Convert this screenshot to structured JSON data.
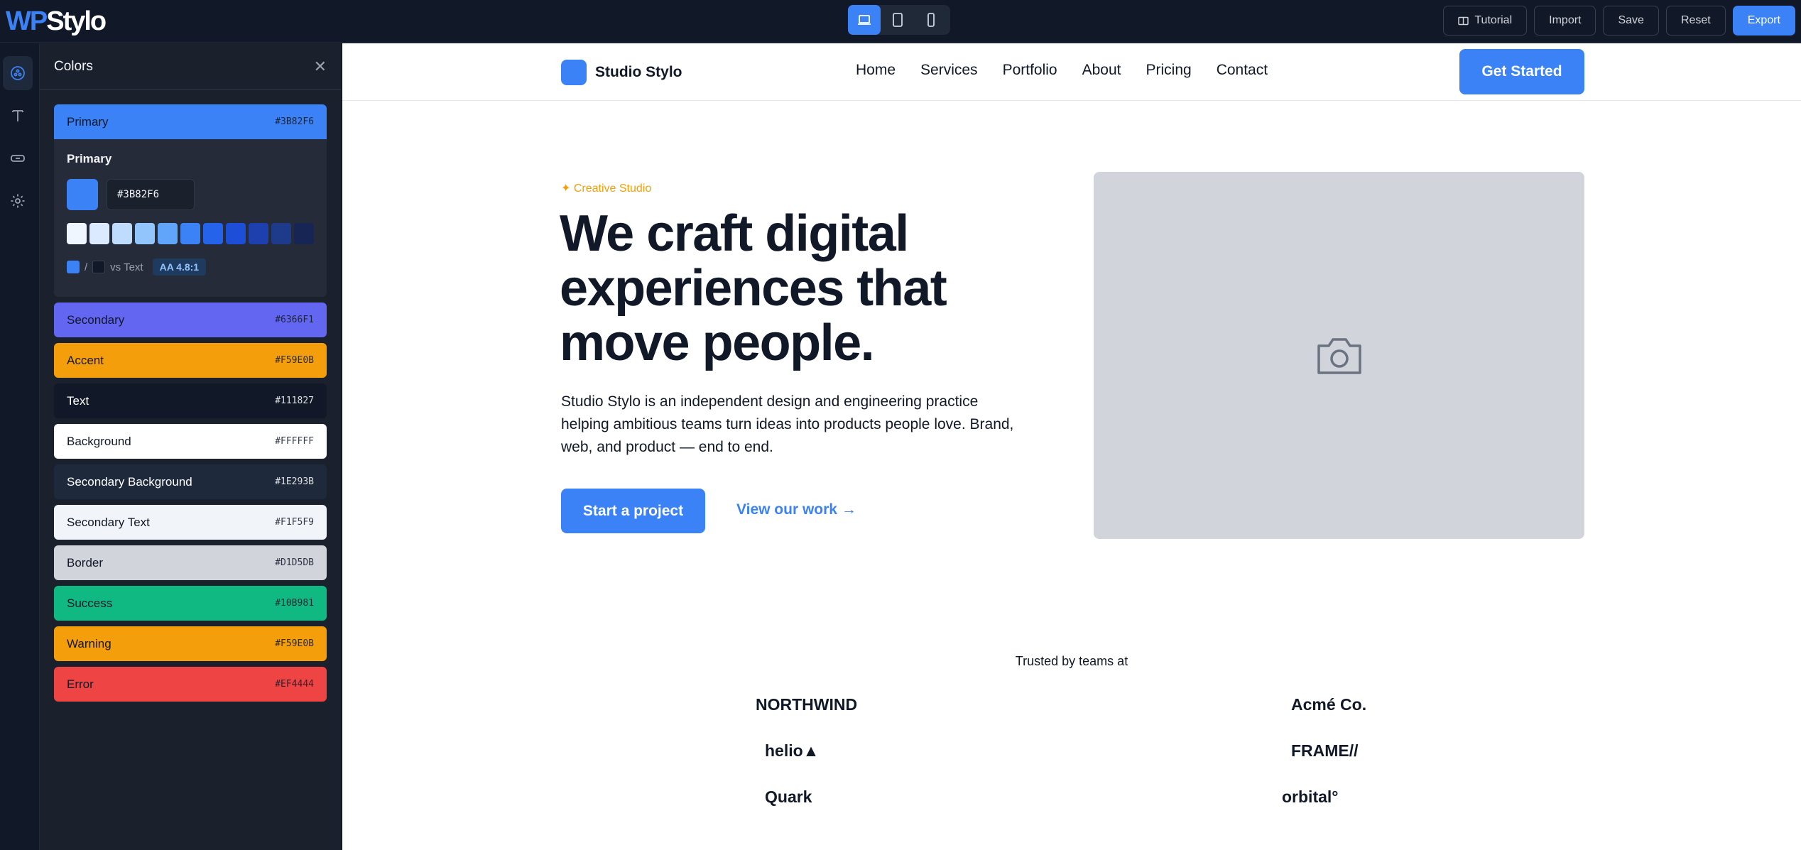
{
  "app": {
    "logo_wp": "WP",
    "logo_stylo": "Stylo"
  },
  "toolbar": {
    "devices": [
      {
        "name": "desktop-icon",
        "active": true
      },
      {
        "name": "tablet-icon",
        "active": false
      },
      {
        "name": "mobile-icon",
        "active": false
      }
    ],
    "tutorial_label": "Tutorial",
    "import_label": "Import",
    "save_label": "Save",
    "reset_label": "Reset",
    "export_label": "Export"
  },
  "rail": {
    "items": [
      {
        "icon": "palette-icon",
        "active": true
      },
      {
        "icon": "typography-icon",
        "active": false
      },
      {
        "icon": "button-icon",
        "active": false
      },
      {
        "icon": "gear-icon",
        "active": false
      }
    ]
  },
  "panel": {
    "title": "Colors",
    "close_icon": "close-icon",
    "colors": [
      {
        "label": "Primary",
        "hex": "#3B82F6",
        "bg": "#3B82F6",
        "fg": "#111827"
      },
      {
        "label": "Secondary",
        "hex": "#6366F1",
        "bg": "#6366F1",
        "fg": "#111827"
      },
      {
        "label": "Accent",
        "hex": "#F59E0B",
        "bg": "#F59E0B",
        "fg": "#111827"
      },
      {
        "label": "Text",
        "hex": "#111827",
        "bg": "#111827",
        "fg": "#FFFFFF"
      },
      {
        "label": "Background",
        "hex": "#FFFFFF",
        "bg": "#FFFFFF",
        "fg": "#111827"
      },
      {
        "label": "Secondary Background",
        "hex": "#1E293B",
        "bg": "#1E293B",
        "fg": "#FFFFFF"
      },
      {
        "label": "Secondary Text",
        "hex": "#F1F5F9",
        "bg": "#F1F5F9",
        "fg": "#111827"
      },
      {
        "label": "Border",
        "hex": "#D1D5DB",
        "bg": "#D1D5DB",
        "fg": "#111827"
      },
      {
        "label": "Success",
        "hex": "#10B981",
        "bg": "#10B981",
        "fg": "#111827"
      },
      {
        "label": "Warning",
        "hex": "#F59E0B",
        "bg": "#F59E0B",
        "fg": "#111827"
      },
      {
        "label": "Error",
        "hex": "#EF4444",
        "bg": "#EF4444",
        "fg": "#111827"
      }
    ],
    "editor": {
      "title": "Primary",
      "hex_value": "#3B82F6",
      "shades": [
        "#EFF6FF",
        "#DBEAFE",
        "#BFDBFE",
        "#93C5FD",
        "#60A5FA",
        "#3B82F6",
        "#2563EB",
        "#1D4ED8",
        "#1E40AF",
        "#1E3A8A",
        "#172554"
      ],
      "contrast_separator": "/",
      "contrast_text": "vs Text",
      "contrast_badge": "AA 4.8:1"
    }
  },
  "preview": {
    "brand_name": "Studio Stylo",
    "nav_links": [
      "Home",
      "Services",
      "Portfolio",
      "About",
      "Pricing",
      "Contact"
    ],
    "nav_cta": "Get Started",
    "eyebrow": "✦ Creative Studio",
    "hero_title": "We craft digital experiences that move people.",
    "hero_body": "Studio Stylo is an independent design and engineering practice helping ambitious teams turn ideas into products people love. Brand, web, and product — end to end.",
    "hero_button": "Start a project",
    "hero_link": "View our work →",
    "image_icon": "camera-icon",
    "trusted_label": "Trusted by teams at",
    "logos": [
      "NORTHWIND",
      "Acmé Co.",
      "helio▲",
      "FRAME//",
      "Quark",
      "orbital°"
    ]
  }
}
